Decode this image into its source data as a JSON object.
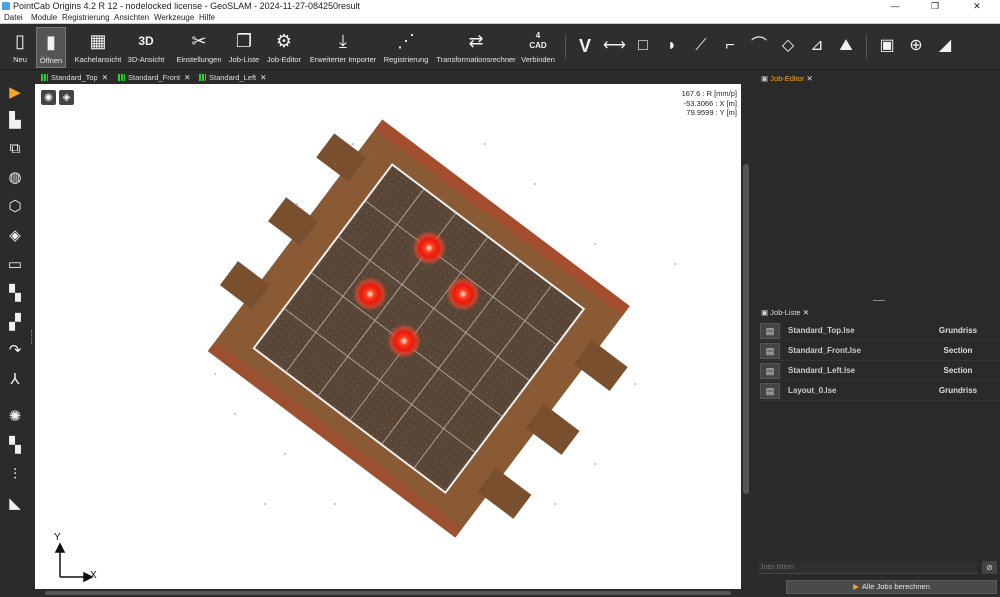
{
  "window": {
    "title": "PointCab Origins 4.2 R 12 - nodelocked license - GeoSLAM - 2024-11-27-084250result",
    "minimize": "—",
    "maximize": "❐",
    "close": "✕"
  },
  "menu": [
    "Datei",
    "Module",
    "Registrierung",
    "Ansichten",
    "Werkzeuge",
    "Hilfe"
  ],
  "toolbar": {
    "buttons": [
      {
        "label": "Neu",
        "icon": "new-file-icon",
        "glyph": "▯"
      },
      {
        "label": "Öffnen",
        "icon": "open-folder-icon",
        "glyph": "▮"
      },
      {
        "label": "Kachelansicht",
        "icon": "tile-view-icon",
        "glyph": "▦"
      },
      {
        "label": "3D-Ansicht",
        "icon": "3d-view-icon",
        "glyph": "3D"
      },
      {
        "label": "Einstellungen",
        "icon": "settings-tools-icon",
        "glyph": "✂"
      },
      {
        "label": "Job-Liste",
        "icon": "job-list-icon",
        "glyph": "❐"
      },
      {
        "label": "Job-Editor",
        "icon": "job-editor-icon",
        "glyph": "⚙"
      },
      {
        "label": "Erweiterter Importer",
        "icon": "download-icon",
        "glyph": "⤓"
      },
      {
        "label": "Registrierung",
        "icon": "registration-icon",
        "glyph": "⋰"
      },
      {
        "label": "Transformationsrechner",
        "icon": "transform-icon",
        "glyph": "⇄"
      },
      {
        "label": "Verbinden",
        "icon": "cad-connect-icon",
        "glyph": "4\nCAD"
      }
    ],
    "tools": [
      {
        "name": "vertex-tool-icon",
        "glyph": "V"
      },
      {
        "name": "line-tool-icon",
        "glyph": "⟷"
      },
      {
        "name": "rectangle-tool-icon",
        "glyph": "□"
      },
      {
        "name": "point-tool-icon",
        "glyph": "◗"
      },
      {
        "name": "polyline-tool-icon",
        "glyph": "⟋"
      },
      {
        "name": "angle-tool-icon",
        "glyph": "⌐"
      },
      {
        "name": "arc-tool-icon",
        "glyph": "⌒"
      },
      {
        "name": "circle-tool-icon",
        "glyph": "◇"
      },
      {
        "name": "measure-angle-icon",
        "glyph": "⊿"
      },
      {
        "name": "terrain-tool-icon",
        "glyph": "⛰"
      },
      {
        "name": "image-tool-icon",
        "glyph": "▣"
      },
      {
        "name": "crosshair-tool-icon",
        "glyph": "⊕"
      },
      {
        "name": "triangle-ruler-icon",
        "glyph": "◢"
      }
    ]
  },
  "leftbar": [
    {
      "name": "select-arrow-icon",
      "glyph": "▶"
    },
    {
      "name": "layers-icon",
      "glyph": "▙"
    },
    {
      "name": "copy-icon",
      "glyph": "⧉"
    },
    {
      "name": "globe-icon",
      "glyph": "◍"
    },
    {
      "name": "polygon-icon",
      "glyph": "⬡"
    },
    {
      "name": "cube-icon",
      "glyph": "◈"
    },
    {
      "name": "cylinder-icon",
      "glyph": "▭"
    },
    {
      "name": "map-icon",
      "glyph": "▚"
    },
    {
      "name": "map-fold-icon",
      "glyph": "▞"
    },
    {
      "name": "path-arrow-icon",
      "glyph": "↷"
    },
    {
      "name": "axes-icon",
      "glyph": "⅄"
    },
    {
      "name": "light-icon",
      "glyph": "✺"
    },
    {
      "name": "checker-icon",
      "glyph": "▚"
    },
    {
      "name": "split-icon",
      "glyph": "⫶"
    },
    {
      "name": "flag-icon",
      "glyph": "◣"
    }
  ],
  "view_tabs": [
    "Standard_Top",
    "Standard_Front",
    "Standard_Left"
  ],
  "viewport": {
    "eye_glyph": "◉",
    "layers_glyph": "◈",
    "readout": [
      "167.6 : R [mm/p]",
      "-53.3066 : X [m]",
      "79.9599 : Y [m]"
    ],
    "axis_y": "Y",
    "axis_x": "X"
  },
  "panels": {
    "job_editor_tab": "Job-Editor",
    "job_list_tab": "Job-Liste",
    "close_glyph": "✕",
    "jobs": [
      {
        "name": "Standard_Top.lse",
        "type": "Grundriss"
      },
      {
        "name": "Standard_Front.lse",
        "type": "Section"
      },
      {
        "name": "Standard_Left.lse",
        "type": "Section"
      },
      {
        "name": "Layout_0.lse",
        "type": "Grundriss"
      }
    ],
    "filter_placeholder": "Jobs filtern",
    "compute_button": "Alle Jobs berechnen"
  },
  "colors": {
    "accent": "#f5a623",
    "tab_indicator": "#33cc33",
    "target_marker": "#ff2a1a"
  }
}
